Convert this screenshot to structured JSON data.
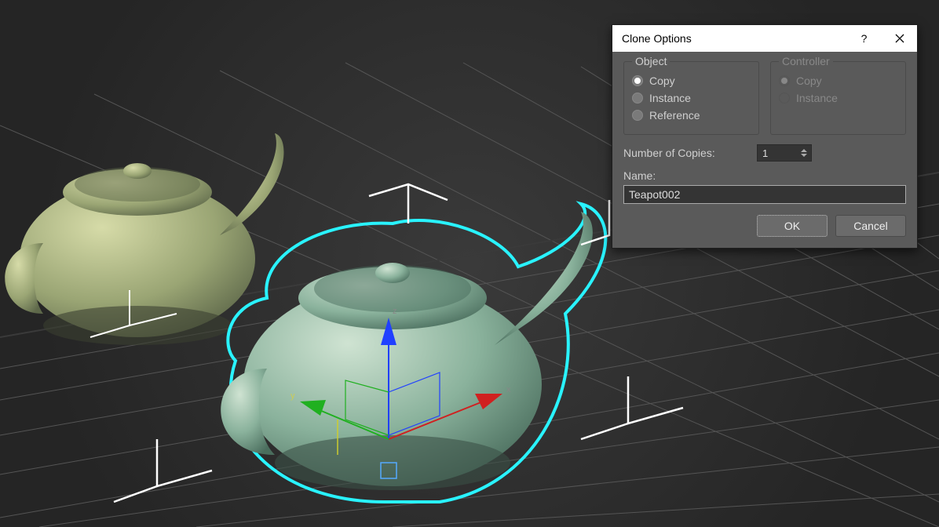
{
  "viewport": {
    "object_original": "Teapot",
    "object_clone": "Teapot",
    "gizmo_axes": {
      "x": "x",
      "y": "y",
      "z": "z"
    }
  },
  "dialog": {
    "title": "Clone Options",
    "help_tooltip": "?",
    "groups": {
      "object": {
        "label": "Object",
        "options": {
          "copy": "Copy",
          "instance": "Instance",
          "reference": "Reference"
        },
        "selected": "copy"
      },
      "controller": {
        "label": "Controller",
        "options": {
          "copy": "Copy",
          "instance": "Instance"
        },
        "selected": "copy",
        "enabled": false
      }
    },
    "copies": {
      "label": "Number of Copies:",
      "value": "1"
    },
    "name": {
      "label": "Name:",
      "value": "Teapot002"
    },
    "buttons": {
      "ok": "OK",
      "cancel": "Cancel"
    }
  }
}
